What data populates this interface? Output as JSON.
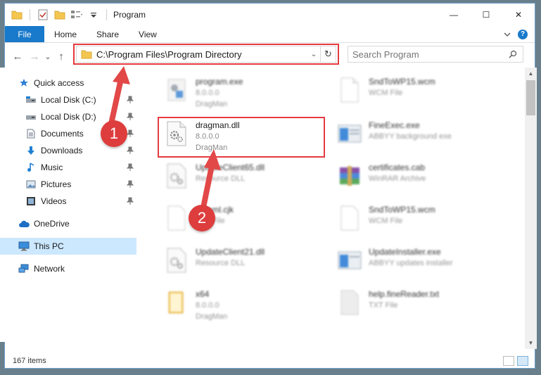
{
  "window": {
    "title": "Program",
    "controls": {
      "minimize": "—",
      "maximize": "☐",
      "close": "✕"
    }
  },
  "ribbon": {
    "tabs": [
      "File",
      "Home",
      "Share",
      "View"
    ],
    "expand_icon": "chevron-down-icon",
    "help_label": "?"
  },
  "navigation": {
    "back_icon": "←",
    "forward_icon": "→",
    "recent_icon": "⌄",
    "up_icon": "↑"
  },
  "address_bar": {
    "path": "C:\\Program Files\\Program Directory",
    "refresh_icon": "↻",
    "dropdown_icon": "⌄"
  },
  "search": {
    "placeholder": "Search Program"
  },
  "sidebar": {
    "items": [
      {
        "label": "Quick access",
        "icon": "star-icon",
        "pinned": false
      },
      {
        "label": "Local Disk (C:)",
        "icon": "drive-icon",
        "pinned": true
      },
      {
        "label": "Local Disk (D:)",
        "icon": "drive-icon",
        "pinned": true
      },
      {
        "label": "Documents",
        "icon": "documents-icon",
        "pinned": true
      },
      {
        "label": "Downloads",
        "icon": "downloads-icon",
        "pinned": true
      },
      {
        "label": "Music",
        "icon": "music-icon",
        "pinned": true
      },
      {
        "label": "Pictures",
        "icon": "pictures-icon",
        "pinned": true
      },
      {
        "label": "Videos",
        "icon": "videos-icon",
        "pinned": true
      },
      {
        "label": "OneDrive",
        "icon": "cloud-icon",
        "pinned": false
      },
      {
        "label": "This PC",
        "icon": "computer-icon",
        "pinned": false,
        "selected": true
      },
      {
        "label": "Network",
        "icon": "network-icon",
        "pinned": false
      }
    ]
  },
  "files": [
    {
      "name": "program.exe",
      "line2": "8.0.0.0",
      "line3": "DragMan",
      "icon": "exe-icon",
      "blurred": true
    },
    {
      "name": "SndToWP15.wcm",
      "line2": "WCM File",
      "line3": "",
      "icon": "blank-file-icon",
      "blurred": true
    },
    {
      "name": "dragman.dll",
      "line2": "8.0.0.0",
      "line3": "DragMan",
      "icon": "dll-gear-icon",
      "blurred": false
    },
    {
      "name": "FineExec.exe",
      "line2": "ABBYY background exe",
      "line3": "",
      "icon": "window-app-icon",
      "blurred": true
    },
    {
      "name": "UpdateClient65.dll",
      "line2": "Resource DLL",
      "line3": "",
      "icon": "dll-gear-icon",
      "blurred": true
    },
    {
      "name": "certificates.cab",
      "line2": "WinRAR Archive",
      "line3": "",
      "icon": "archive-icon",
      "blurred": true
    },
    {
      "name": "hmeml.cjk",
      "line2": "CJK File",
      "line3": "",
      "icon": "blank-file-icon",
      "blurred": true
    },
    {
      "name": "SndToWP15.wcm",
      "line2": "WCM File",
      "line3": "",
      "icon": "blank-file-icon",
      "blurred": true
    },
    {
      "name": "UpdateClient21.dll",
      "line2": "Resource DLL",
      "line3": "",
      "icon": "dll-gear-icon",
      "blurred": true
    },
    {
      "name": "UpdateInstaller.exe",
      "line2": "ABBYY updates installer",
      "line3": "",
      "icon": "window-app-icon",
      "blurred": true
    },
    {
      "name": "x64",
      "line2": "8.0.0.0",
      "line3": "DragMan",
      "icon": "folder-icon",
      "blurred": true
    },
    {
      "name": "help.fineReader.txt",
      "line2": "TXT File",
      "line3": "",
      "icon": "txt-file-icon",
      "blurred": true
    }
  ],
  "status": {
    "item_count": "167 items"
  },
  "callouts": [
    "1",
    "2"
  ],
  "colors": {
    "accent": "#1979ca",
    "highlight": "#e53b3f",
    "callout": "#de3d3d",
    "selected_bg": "#cce8ff"
  }
}
